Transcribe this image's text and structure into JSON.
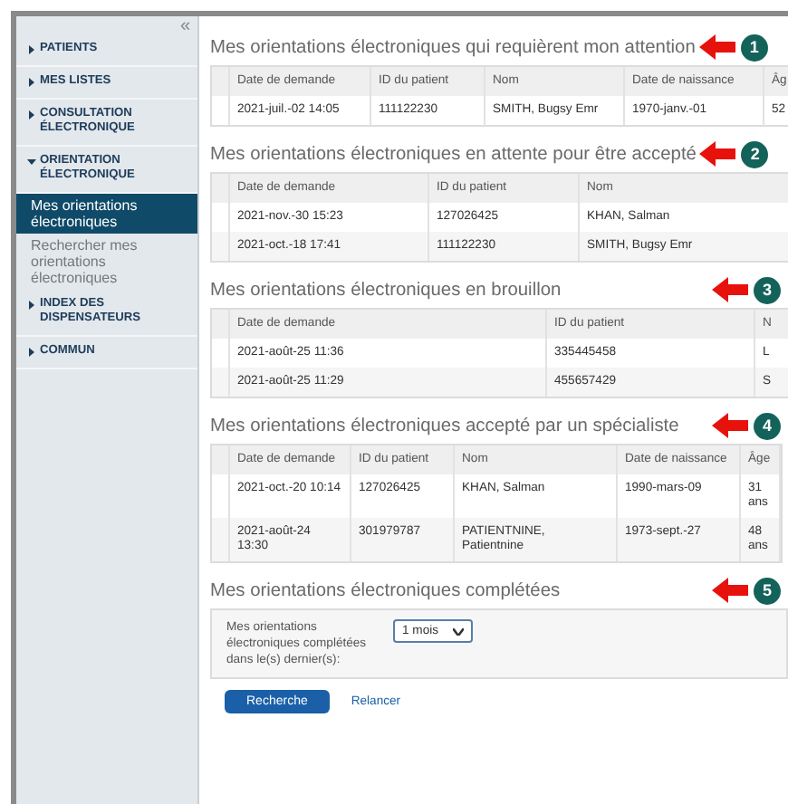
{
  "sidebar": {
    "collapse": "«",
    "items": [
      {
        "label": "PATIENTS",
        "expanded": false
      },
      {
        "label": "MES LISTES",
        "expanded": false
      },
      {
        "label": "CONSULTATION ÉLECTRONIQUE",
        "expanded": false
      },
      {
        "label": "ORIENTATION ÉLECTRONIQUE",
        "expanded": true,
        "children": [
          {
            "label": "Mes orientations électroniques",
            "selected": true
          },
          {
            "label": "Rechercher mes orientations électroniques",
            "selected": false
          }
        ]
      },
      {
        "label": "INDEX DES DISPENSATEURS",
        "expanded": false
      },
      {
        "label": "COMMUN",
        "expanded": false
      }
    ]
  },
  "sections": [
    {
      "title": "Mes orientations électroniques qui requièrent mon attention",
      "badge": "1",
      "table": {
        "columns": [
          "Date de demande",
          "ID du patient",
          "Nom",
          "Date de naissance",
          "Âg"
        ],
        "rows": [
          [
            "2021-juil.-02 14:05",
            "111122230",
            "SMITH, Bugsy Emr",
            "1970-janv.-01",
            "52"
          ]
        ]
      }
    },
    {
      "title": "Mes orientations électroniques en attente pour être accepté",
      "badge": "2",
      "table": {
        "columns": [
          "Date de demande",
          "ID du patient",
          "Nom"
        ],
        "rows": [
          [
            "2021-nov.-30 15:23",
            "127026425",
            "KHAN, Salman"
          ],
          [
            "2021-oct.-18 17:41",
            "111122230",
            "SMITH, Bugsy Emr"
          ]
        ]
      }
    },
    {
      "title": "Mes orientations électroniques en brouillon",
      "badge": "3",
      "table": {
        "columns": [
          "Date de demande",
          "ID du patient",
          "N"
        ],
        "rows": [
          [
            "2021-août-25 11:36",
            "335445458",
            "L"
          ],
          [
            "2021-août-25 11:29",
            "455657429",
            "S"
          ]
        ]
      }
    },
    {
      "title": "Mes orientations électroniques accepté par un spécialiste",
      "badge": "4",
      "table": {
        "columns": [
          "Date de demande",
          "ID du patient",
          "Nom",
          "Date de naissance",
          "Âge"
        ],
        "rows": [
          [
            "2021-oct.-20 10:14",
            "127026425",
            "KHAN, Salman",
            "1990-mars-09",
            "31 ans"
          ],
          [
            "2021-août-24 13:30",
            "301979787",
            "PATIENTNINE, Patientnine",
            "1973-sept.-27",
            "48 ans"
          ]
        ]
      }
    },
    {
      "title": "Mes orientations électroniques complétées",
      "badge": "5",
      "form": {
        "label": "Mes orientations électroniques complétées dans le(s) dernier(s):",
        "value": "1 mois",
        "buttons": [
          {
            "label": "Recherche",
            "kind": "primary"
          },
          {
            "label": "Relancer",
            "kind": "link"
          }
        ]
      }
    }
  ]
}
